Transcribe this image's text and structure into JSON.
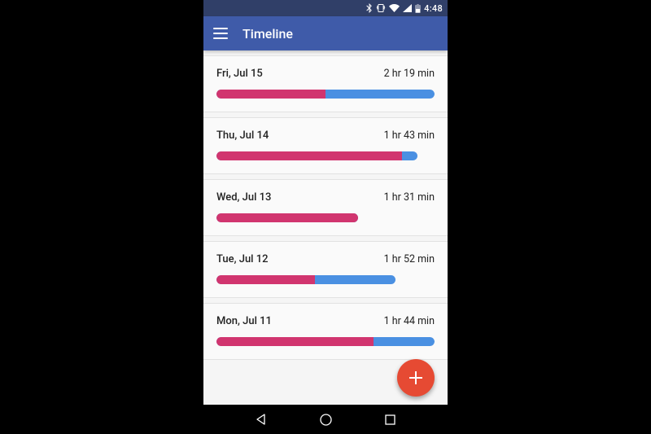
{
  "status": {
    "time": "4:48"
  },
  "appbar": {
    "title": "Timeline"
  },
  "timeline": [
    {
      "date": "Fri, Jul 15",
      "duration": "2 hr 19 min",
      "pink_pct": 50,
      "blue_pct": 100
    },
    {
      "date": "Thu, Jul 14",
      "duration": "1 hr 43 min",
      "pink_pct": 85,
      "blue_pct": 92
    },
    {
      "date": "Wed, Jul 13",
      "duration": "1 hr 31 min",
      "pink_pct": 65,
      "blue_pct": 65
    },
    {
      "date": "Tue, Jul 12",
      "duration": "1 hr 52 min",
      "pink_pct": 45,
      "blue_pct": 82
    },
    {
      "date": "Mon, Jul 11",
      "duration": "1 hr 44 min",
      "pink_pct": 72,
      "blue_pct": 100
    }
  ],
  "colors": {
    "pink": "#d1356f",
    "blue": "#4a90e2",
    "appbar": "#3f5ba9",
    "fab": "#e64a33"
  }
}
